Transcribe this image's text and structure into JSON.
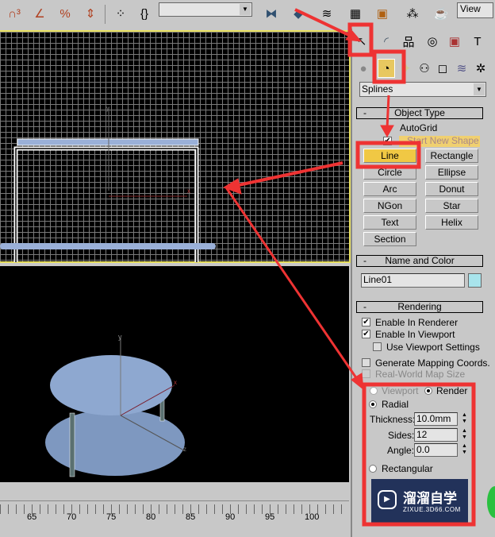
{
  "toolbar": {
    "icons": [
      "snap-3d-icon",
      "angle-snap-icon",
      "percent-snap-icon",
      "spinner-snap-icon",
      "named-selection-icon",
      "edit-named-selection-icon",
      "mirror-icon",
      "align-icon",
      "layer-manager-icon",
      "curve-editor-icon",
      "schematic-view-icon",
      "material-editor-icon",
      "render-setup-icon"
    ],
    "selection_set_value": "",
    "view_label": "View"
  },
  "command_panel": {
    "tabs": [
      "create-tab",
      "modify-tab",
      "hierarchy-tab",
      "motion-tab",
      "display-tab",
      "utilities-tab"
    ],
    "categories": [
      "geometry-icon",
      "shapes-icon",
      "lights-icon",
      "cameras-icon",
      "helpers-icon",
      "space-warps-icon",
      "systems-icon"
    ],
    "dropdown_value": "Splines",
    "object_type": {
      "title": "Object Type",
      "minus": "-",
      "autogrid": "AutoGrid",
      "start_new_shape": "Start New Shape",
      "start_new_shape_checked": true,
      "buttons": [
        "Line",
        "Rectangle",
        "Circle",
        "Ellipse",
        "Arc",
        "Donut",
        "NGon",
        "Star",
        "Text",
        "Helix",
        "Section"
      ],
      "active": "Line"
    },
    "name_and_color": {
      "title": "Name and Color",
      "minus": "-",
      "name": "Line01",
      "color": "#a8e4ec"
    },
    "rendering": {
      "title": "Rendering",
      "minus": "-",
      "enable_in_renderer": "Enable In Renderer",
      "enable_in_renderer_checked": true,
      "enable_in_viewport": "Enable In Viewport",
      "enable_in_viewport_checked": true,
      "use_viewport_settings": "Use Viewport Settings",
      "generate_mapping": "Generate Mapping Coords.",
      "real_world": "Real-World Map Size",
      "viewport": "Viewport",
      "renderer": "Renderer",
      "radial": "Radial",
      "thickness_label": "Thickness:",
      "thickness": "10.0mm",
      "sides_label": "Sides:",
      "sides": "12",
      "angle_label": "Angle:",
      "angle": "0.0",
      "rectangular": "Rectangular"
    }
  },
  "viewports": {
    "top_axis_y": "y",
    "top_axis_x": "x",
    "persp_axis_y": "y",
    "persp_axis_x": "x",
    "persp_axis_z": "z"
  },
  "timeline": {
    "ticks": [
      "65",
      "70",
      "75",
      "80",
      "85",
      "90",
      "95",
      "100"
    ]
  },
  "watermark": {
    "title": "溜溜自学",
    "url": "ZIXUE.3D66.COM"
  },
  "colors": {
    "annotation": "#ee3333",
    "active_button": "#f0c844",
    "viewport_border": "#e8e060",
    "object": "#8aa4cc"
  }
}
